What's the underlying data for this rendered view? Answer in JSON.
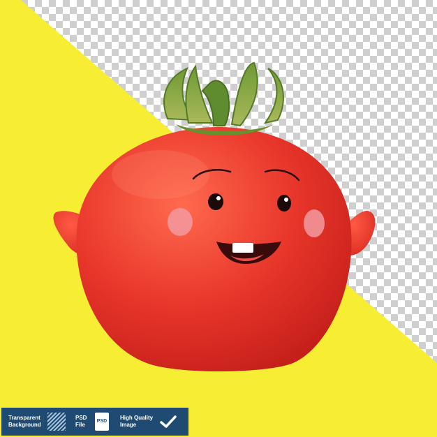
{
  "colors": {
    "background_yellow": "#f7ee33",
    "tomato_red": "#e8362b",
    "leaf_green": "#7fa03a",
    "badge_blue": "#1f4b73"
  },
  "badge": {
    "transparent_line1": "Transparent",
    "transparent_line2": "Background",
    "psd_line1": "PSD",
    "psd_line2": "File",
    "psd_icon_text": "PSD",
    "hq_line1": "High Quality",
    "hq_line2": "Image"
  },
  "icons": [
    "stripes-icon",
    "psd-file-icon",
    "checkmark-icon"
  ]
}
